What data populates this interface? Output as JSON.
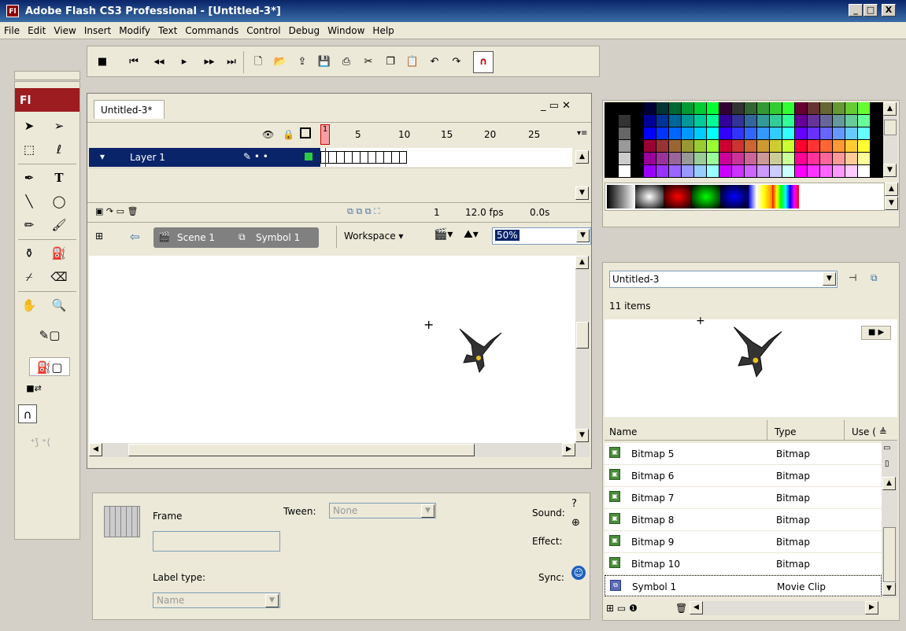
{
  "window": {
    "title": "Adobe Flash CS3 Professional - [Untitled-3*]",
    "logo": "Fl",
    "minimize": "_",
    "maximize": "□",
    "close": "X"
  },
  "menu": [
    "File",
    "Edit",
    "View",
    "Insert",
    "Modify",
    "Text",
    "Commands",
    "Control",
    "Debug",
    "Window",
    "Help"
  ],
  "tools_panel": {
    "logo": "Fl"
  },
  "document": {
    "tab": "Untitled-3*",
    "timeline": {
      "ruler": [
        "1",
        "5",
        "10",
        "15",
        "20",
        "25"
      ],
      "layer_name": "Layer 1",
      "current_frame": "1",
      "fps": "12.0 fps",
      "elapsed": "0.0s"
    },
    "scene": "Scene 1",
    "symbol": "Symbol 1",
    "workspace_label": "Workspace ▾",
    "zoom": "50%"
  },
  "properties": {
    "frame_label": "Frame",
    "tween_label": "Tween:",
    "tween_value": "None",
    "label_type_label": "Label type:",
    "label_type_value": "Name",
    "sound_label": "Sound:",
    "effect_label": "Effect:",
    "sync_label": "Sync:"
  },
  "library": {
    "document": "Untitled-3",
    "item_count": "11 items",
    "columns": {
      "name": "Name",
      "type": "Type",
      "use": "Use ( ≜"
    },
    "rows": [
      {
        "name": "Bitmap 5",
        "type": "Bitmap",
        "icon": "bitmap-icon"
      },
      {
        "name": "Bitmap 6",
        "type": "Bitmap",
        "icon": "bitmap-icon"
      },
      {
        "name": "Bitmap 7",
        "type": "Bitmap",
        "icon": "bitmap-icon"
      },
      {
        "name": "Bitmap 8",
        "type": "Bitmap",
        "icon": "bitmap-icon"
      },
      {
        "name": "Bitmap 9",
        "type": "Bitmap",
        "icon": "bitmap-icon"
      },
      {
        "name": "Bitmap 10",
        "type": "Bitmap",
        "icon": "bitmap-icon"
      },
      {
        "name": "Symbol 1",
        "type": "Movie Clip",
        "icon": "movie-clip-icon"
      }
    ]
  },
  "colors": {
    "title_bar": "#0a246a",
    "flash_red": "#9c1c20",
    "layer_selected": "#0a246a",
    "playhead": "#cc0000"
  }
}
